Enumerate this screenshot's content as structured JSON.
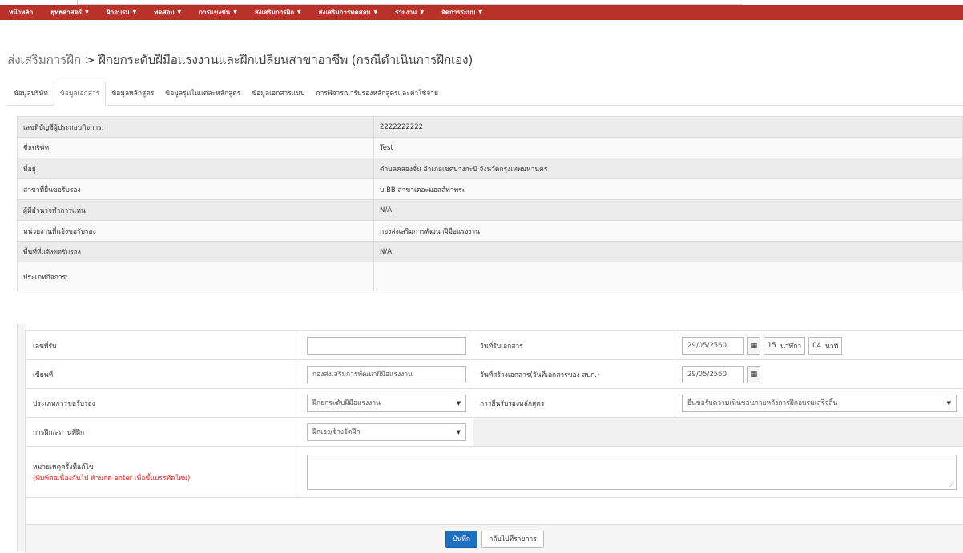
{
  "nav": {
    "items": [
      {
        "label": "หน้าหลัก",
        "caret": false
      },
      {
        "label": "ยุทธศาสตร์",
        "caret": true
      },
      {
        "label": "ฝึกอบรม",
        "caret": true
      },
      {
        "label": "ทดสอบ",
        "caret": true
      },
      {
        "label": "การแข่งขัน",
        "caret": true
      },
      {
        "label": "ส่งเสริมการฝึก",
        "caret": true
      },
      {
        "label": "ส่งเสริมการทดสอบ",
        "caret": true
      },
      {
        "label": "รายงาน",
        "caret": true
      },
      {
        "label": "จัดการระบบ",
        "caret": true
      }
    ]
  },
  "page": {
    "crumb": "ส่งเสริมการฝึก",
    "separator": ">",
    "title": "ฝึกยกระดับฝีมือแรงงานและฝึกเปลี่ยนสาขาอาชีพ (กรณีดำเนินการฝึกเอง)"
  },
  "tabs": [
    {
      "label": "ข้อมูลบริษัท",
      "active": false
    },
    {
      "label": "ข้อมูลเอกสาร",
      "active": true
    },
    {
      "label": "ข้อมูลหลักสูตร",
      "active": false
    },
    {
      "label": "ข้อมูลรุ่นในแต่ละหลักสูตร",
      "active": false
    },
    {
      "label": "ข้อมูลเอกสารแนบ",
      "active": false
    },
    {
      "label": "การพิจารณารับรองหลักสูตรและค่าใช้จ่าย",
      "active": false
    }
  ],
  "company_info": {
    "account_no": {
      "label": "เลขที่บัญชีผู้ประกอบกิจการ:",
      "value": "2222222222"
    },
    "company_name": {
      "label": "ชื่อบริษัท:",
      "value": "Test"
    },
    "address": {
      "label": "ที่อยู่",
      "value": "ตำบลคลองจั่น อำเภอเขตบางกะปิ จังหวัดกรุงเทพมหานคร"
    },
    "branch": {
      "label": "สาขาที่ยื่นขอรับรอง",
      "value": "บ.BB สาขาเดอะมอลล์ท่าพระ"
    },
    "authorized": {
      "label": "ผู้มีอำนาจทำการแทน",
      "value": "N/A"
    },
    "agency": {
      "label": "หน่วยงานที่แจ้งขอรับรอง",
      "value": "กองส่งเสริมการพัฒนาฝีมือแรงงาน"
    },
    "area": {
      "label": "พื้นที่ที่แจ้งขอรับรอง",
      "value": "N/A"
    },
    "business_type": {
      "label": "ประเภทกิจการ:",
      "value": ""
    }
  },
  "form": {
    "receive_no": {
      "label": "เลขที่รับ",
      "value": ""
    },
    "receive_date": {
      "label": "วันที่รับเอกสาร",
      "date": "29/05/2560",
      "hour": "15",
      "hour_unit": "นาฬิกา",
      "minute": "04",
      "minute_unit": "นาที"
    },
    "written_at": {
      "label": "เขียนที่",
      "value": "กองส่งเสริมการพัฒนาฝีมือแรงงาน"
    },
    "created_date": {
      "label": "วันที่สร้างเอกสาร(วันที่เอกสารของ สปก.)",
      "date": "29/05/2560"
    },
    "cert_type": {
      "label": "ประเภทการขอรับรอง",
      "selected": "ฝึกยกระดับฝีมือแรงงาน"
    },
    "course_cert": {
      "label": "การยื่นรับรองหลักสูตร",
      "selected": "ยื่นขอรับความเห็นชอบภายหลังการฝึกอบรมเสร็จสิ้น"
    },
    "training_place": {
      "label": "การฝึก/สถานที่ฝึก",
      "selected": "ฝึกเอง/จ้างจัดฝึก"
    },
    "remark": {
      "label": "หมายเหตุครั้งที่แก้ไข",
      "hint": "(พิมพ์ต่อเนื่องกันไป ห้ามกด enter เพื่อขึ้นบรรทัดใหม่)",
      "value": ""
    },
    "save_label": "บันทึก",
    "back_label": "กลับไปที่รายการ"
  },
  "icons": {
    "calendar": "calendar-icon",
    "dropdown": "chevron-down-icon"
  },
  "colors": {
    "navbar": "#b8322a",
    "primary_button": "#1e6fc0",
    "hint_red": "#e02020"
  }
}
